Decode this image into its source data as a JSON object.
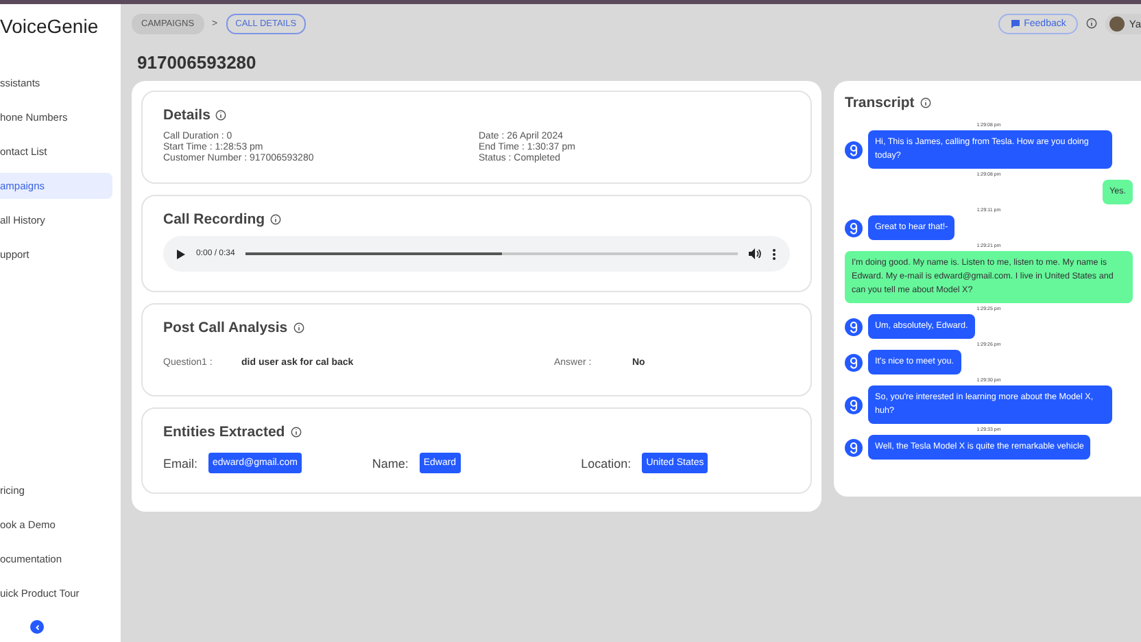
{
  "sidebar": {
    "logo": "VoiceGenie",
    "items": [
      {
        "label": "ssistants",
        "selected": false
      },
      {
        "label": "hone Numbers",
        "selected": false
      },
      {
        "label": "ontact List",
        "selected": false
      },
      {
        "label": "ampaigns",
        "selected": true
      },
      {
        "label": "all History",
        "selected": false
      },
      {
        "label": "upport",
        "selected": false
      }
    ],
    "bottom_items": [
      "ricing",
      "ook a Demo",
      "ocumentation",
      "uick Product Tour"
    ]
  },
  "breadcrumb": [
    {
      "label": "CAMPAIGNS",
      "selected": false
    },
    {
      "label": "CALL DETAILS",
      "selected": true
    }
  ],
  "breadcrumb_separator": ">",
  "header": {
    "feedback": "Feedback",
    "user": "Ya"
  },
  "page_title": "917006593280",
  "details": {
    "title": "Details",
    "fields": [
      "Call Duration : 0",
      "Date : 26 April 2024",
      "Start Time : 1:28:53 pm",
      "End Time : 1:30:37 pm",
      "Customer Number : 917006593280",
      "Status : Completed"
    ]
  },
  "recording": {
    "title": "Call Recording",
    "time": "0:00 / 0:34",
    "level": 0.52
  },
  "analysis": {
    "title": "Post Call Analysis",
    "question_label": "Question1 :",
    "question": "did user ask for cal back",
    "answer_label": "Answer :",
    "answer": "No"
  },
  "entities": {
    "title": "Entities Extracted",
    "items": [
      {
        "label": "Email:",
        "value": "edward@gmail.com"
      },
      {
        "label": "Name:",
        "value": "Edward"
      },
      {
        "label": "Location:",
        "value": "United States"
      }
    ]
  },
  "transcript": {
    "title": "Transcript",
    "messages": [
      {
        "kind": "agent",
        "time": "1:29:08 pm",
        "text": "Hi, This is James, calling from Tesla. How are you doing today?"
      },
      {
        "kind": "user",
        "time": "1:29:08 pm",
        "text": "Yes."
      },
      {
        "kind": "agent",
        "time": "1:29:11 pm",
        "text": "Great to hear that!-"
      },
      {
        "kind": "user",
        "time": "1:29:21 pm",
        "text": "I'm doing good. My name is. Listen to me, listen to me. My name is Edward. My e-mail is edward@gmail.com. I live in United States and can you tell me about Model X?"
      },
      {
        "kind": "agent",
        "time": "1:29:25 pm",
        "text": "Um, absolutely, Edward."
      },
      {
        "kind": "agent",
        "time": "1:29:26 pm",
        "text": "It's nice to meet you."
      },
      {
        "kind": "agent",
        "time": "1:29:30 pm",
        "text": "So, you're interested in learning more about the Model X, huh?"
      },
      {
        "kind": "agent",
        "time": "1:29:33 pm",
        "text": "Well, the Tesla Model X is quite the remarkable vehicle"
      }
    ]
  }
}
